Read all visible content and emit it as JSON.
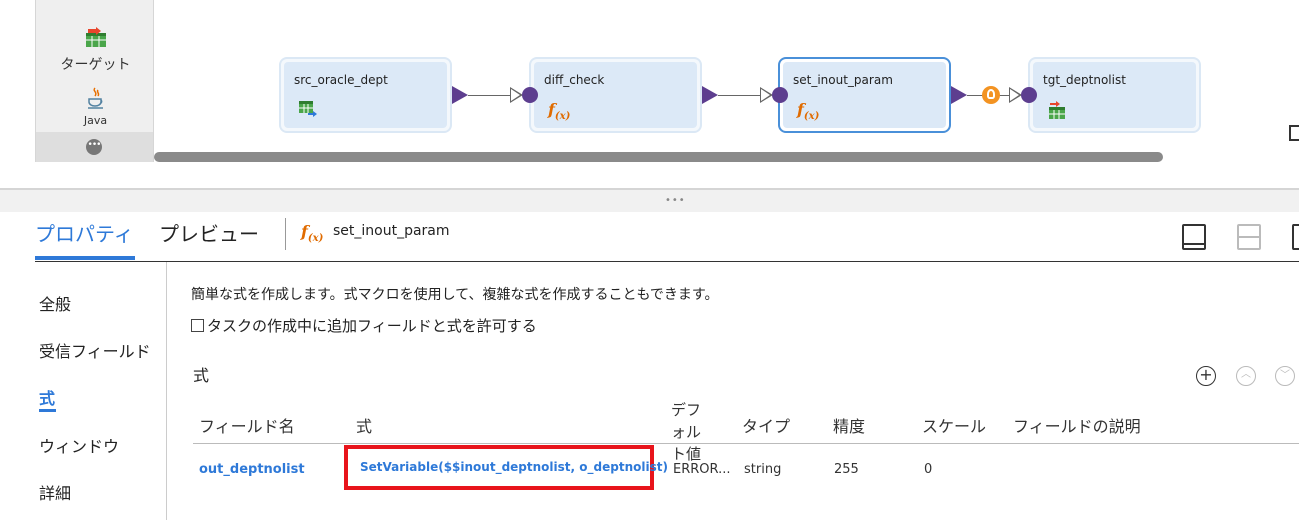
{
  "palette": {
    "target_label": "ターゲット",
    "java_label": "Java",
    "more_label": "•••"
  },
  "mapping": {
    "nodes": [
      {
        "title": "src_oracle_dept",
        "icon": "source-table-icon"
      },
      {
        "title": "diff_check",
        "icon": "expression-fx-icon"
      },
      {
        "title": "set_inout_param",
        "icon": "expression-fx-icon",
        "selected": true
      },
      {
        "title": "tgt_deptnolist",
        "icon": "target-table-icon"
      }
    ],
    "fx_glyph": "f",
    "fx_sub": "(x)"
  },
  "splitter": {
    "grip": "•••"
  },
  "panel": {
    "tabs": [
      {
        "label": "プロパティ",
        "active": true
      },
      {
        "label": "プレビュー",
        "active": false
      }
    ],
    "object_name": "set_inout_param",
    "sidebar": [
      {
        "label": "全般"
      },
      {
        "label": "受信フィールド"
      },
      {
        "label": "式",
        "active": true
      },
      {
        "label": "ウィンドウ"
      },
      {
        "label": "詳細"
      }
    ],
    "description": "簡単な式を作成します。式マクロを使用して、複雑な式を作成することもできます。",
    "allow_checkbox_label": "タスクの作成中に追加フィールドと式を許可する",
    "allow_checked": false,
    "section_title": "式",
    "add_glyph": "+",
    "up_glyph": "︿",
    "down_glyph": "﹀",
    "columns": {
      "field": "フィールド名",
      "expr": "式",
      "default": "デフォルト値",
      "type": "タイプ",
      "precision": "精度",
      "scale": "スケール",
      "desc": "フィールドの説明"
    },
    "rows": [
      {
        "field": "out_deptnolist",
        "expr": "SetVariable($$inout_deptnolist, o_deptnolist)",
        "default": "ERROR...",
        "type": "string",
        "precision": "255",
        "scale": "0",
        "desc": ""
      }
    ]
  },
  "colors": {
    "accent": "#2e79d8",
    "port": "#5d3e8f",
    "highlight": "#e8141b",
    "fx": "#e06b00"
  }
}
